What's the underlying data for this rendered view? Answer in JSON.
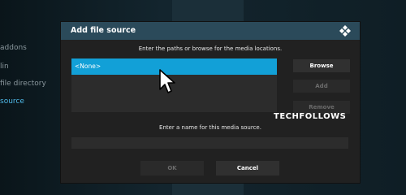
{
  "background": {
    "menu_items": [
      "addons",
      "lin",
      "file directory",
      "source"
    ]
  },
  "dialog": {
    "title": "Add file source",
    "instruction_paths": "Enter the paths or browse for the media locations.",
    "source_list": {
      "selected_item": "<None>"
    },
    "buttons": {
      "browse": "Browse",
      "add": "Add",
      "remove": "Remove",
      "ok": "OK",
      "cancel": "Cancel"
    },
    "instruction_name": "Enter a name for this media source.",
    "name_field": {
      "value": "",
      "placeholder": ""
    }
  },
  "watermark": {
    "part1": "TECH",
    "part2": "FOLLOWS"
  },
  "colors": {
    "header": "#2b4a5a",
    "selection": "#12a0d7",
    "dialog_bg": "#212121"
  },
  "icons": {
    "logo": "kodi-logo-icon",
    "cursor": "mouse-pointer-icon"
  }
}
